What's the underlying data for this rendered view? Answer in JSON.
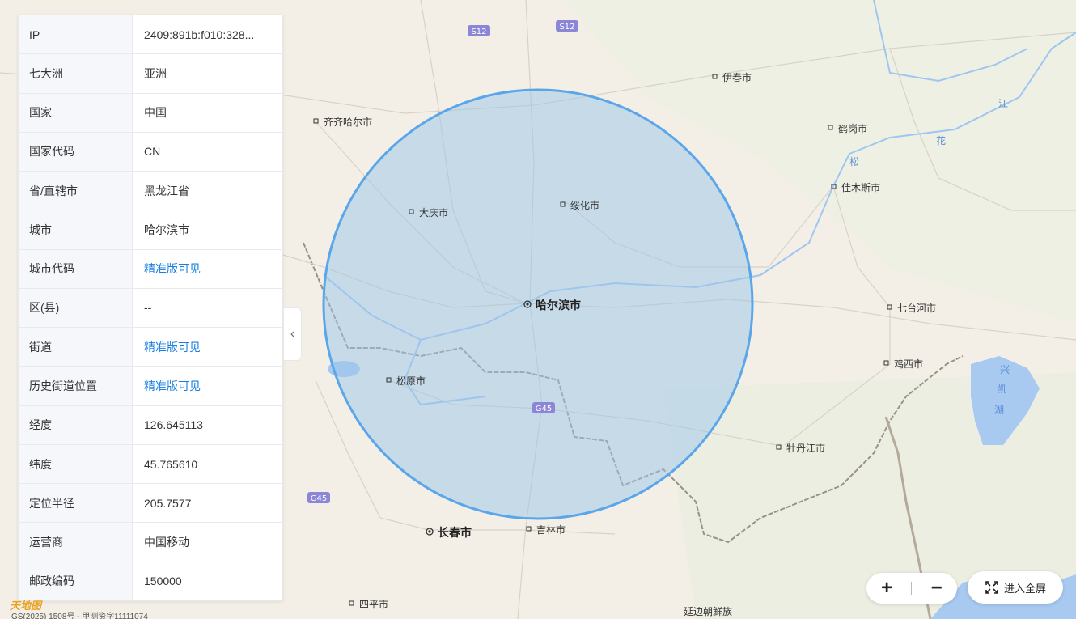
{
  "info": [
    {
      "key": "IP",
      "value": "2409:891b:f010:328...",
      "link": false
    },
    {
      "key": "七大洲",
      "value": "亚洲",
      "link": false
    },
    {
      "key": "国家",
      "value": "中国",
      "link": false
    },
    {
      "key": "国家代码",
      "value": "CN",
      "link": false
    },
    {
      "key": "省/直辖市",
      "value": "黑龙江省",
      "link": false
    },
    {
      "key": "城市",
      "value": "哈尔滨市",
      "link": false
    },
    {
      "key": "城市代码",
      "value": "精准版可见",
      "link": true
    },
    {
      "key": "区(县)",
      "value": "--",
      "link": false
    },
    {
      "key": "街道",
      "value": "精准版可见",
      "link": true
    },
    {
      "key": "历史街道位置",
      "value": "精准版可见",
      "link": true
    },
    {
      "key": "经度",
      "value": "126.645113",
      "link": false
    },
    {
      "key": "纬度",
      "value": "45.765610",
      "link": false
    },
    {
      "key": "定位半径",
      "value": "205.7577",
      "link": false
    },
    {
      "key": "运营商",
      "value": "中国移动",
      "link": false
    },
    {
      "key": "邮政编码",
      "value": "150000",
      "link": false
    }
  ],
  "map": {
    "cities": {
      "harbin": "哈尔滨市",
      "daqing": "大庆市",
      "suihua": "绥化市",
      "qiqihar": "齐齐哈尔市",
      "yichun": "伊春市",
      "hegang": "鹤岗市",
      "jiamusi": "佳木斯市",
      "qitaihe": "七台河市",
      "jixi": "鸡西市",
      "mudanjiang": "牡丹江市",
      "songyuan": "松原市",
      "changchun": "长春市",
      "jilin": "吉林市",
      "siping": "四平市",
      "yanbian": "延边朝鲜族"
    },
    "roads": {
      "s12a": "S12",
      "s12b": "S12",
      "g45a": "G45",
      "g45b": "G45"
    },
    "water": {
      "jiang": "江",
      "hua": "花",
      "song": "松",
      "xing": "兴",
      "kai": "凯",
      "hu": "湖"
    },
    "radius_circle_color": "#5aa6ea"
  },
  "controls": {
    "collapse": "‹",
    "zoom_in": "+",
    "zoom_out": "−",
    "fullscreen": "进入全屏"
  },
  "footer": {
    "logo": "天地图",
    "copyright": "GS(2025) 1508号 - 甲测资字11111074"
  }
}
